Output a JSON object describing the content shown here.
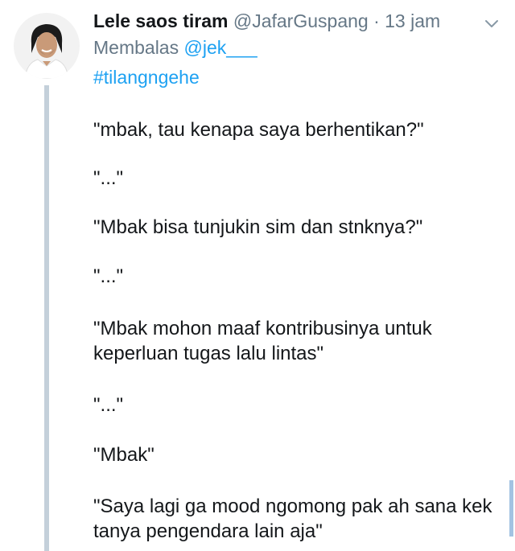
{
  "tweet": {
    "display_name": "Lele saos tiram",
    "handle": "@JafarGuspang",
    "separator": "·",
    "time": "13 jam",
    "reply_prefix": "Membalas",
    "reply_to": "@jek___",
    "hashtag": "#tilangngehe",
    "paragraphs": [
      "\"mbak, tau kenapa saya berhentikan?\"",
      "\"...\"",
      "\"Mbak bisa tunjukin sim dan stnknya?\"",
      "\"...\"",
      "\"Mbak mohon maaf kontribusinya untuk\nkeperluan tugas lalu lintas\"",
      "\"...\"",
      "\"Mbak\"",
      "\"Saya lagi ga mood ngomong pak ah sana kek\ntanya pengendara lain aja\""
    ]
  },
  "icons": {
    "avatar": "avatar-photo",
    "menu": "chevron-down-icon"
  },
  "colors": {
    "link": "#1da1f2",
    "secondary_text": "#657786",
    "thread_line": "#c4d0da"
  }
}
